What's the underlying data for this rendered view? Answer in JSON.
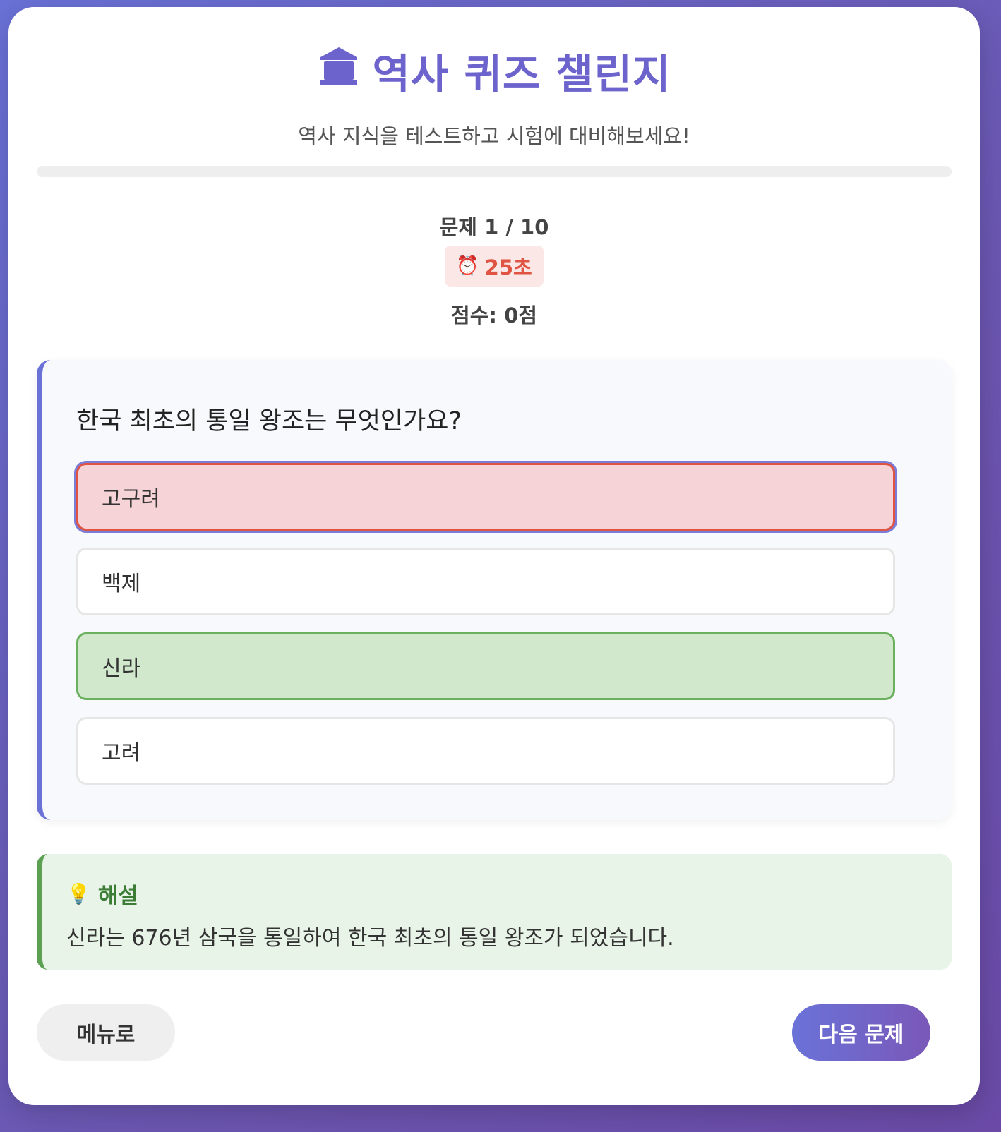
{
  "header": {
    "title": "역사 퀴즈 챌린지",
    "title_icon": "museum-icon",
    "subtitle": "역사 지식을 테스트하고 시험에 대비해보세요!"
  },
  "progress": {
    "fraction": 0.0
  },
  "status": {
    "question_counter": "문제 1 / 10",
    "timer_icon": "alarm-clock-icon",
    "timer": "25초",
    "score": "점수: 0점"
  },
  "quiz": {
    "question": "한국 최초의 통일 왕조는 무엇인가요?",
    "options": [
      {
        "label": "고구려",
        "state": "wrong-selected"
      },
      {
        "label": "백제",
        "state": "default"
      },
      {
        "label": "신라",
        "state": "correct"
      },
      {
        "label": "고려",
        "state": "default"
      }
    ]
  },
  "explanation": {
    "icon": "lightbulb-icon",
    "heading": "해설",
    "text": "신라는 676년 삼국을 통일하여 한국 최초의 통일 왕조가 되었습니다."
  },
  "buttons": {
    "menu_label": "메뉴로",
    "next_label": "다음 문제"
  },
  "colors": {
    "accent": "#6d63cc",
    "wrong_bg": "#f6d3d6",
    "wrong_border": "#e05443",
    "correct_bg": "#d1e8cd",
    "correct_border": "#6bb05f",
    "timer_text": "#e05443"
  }
}
